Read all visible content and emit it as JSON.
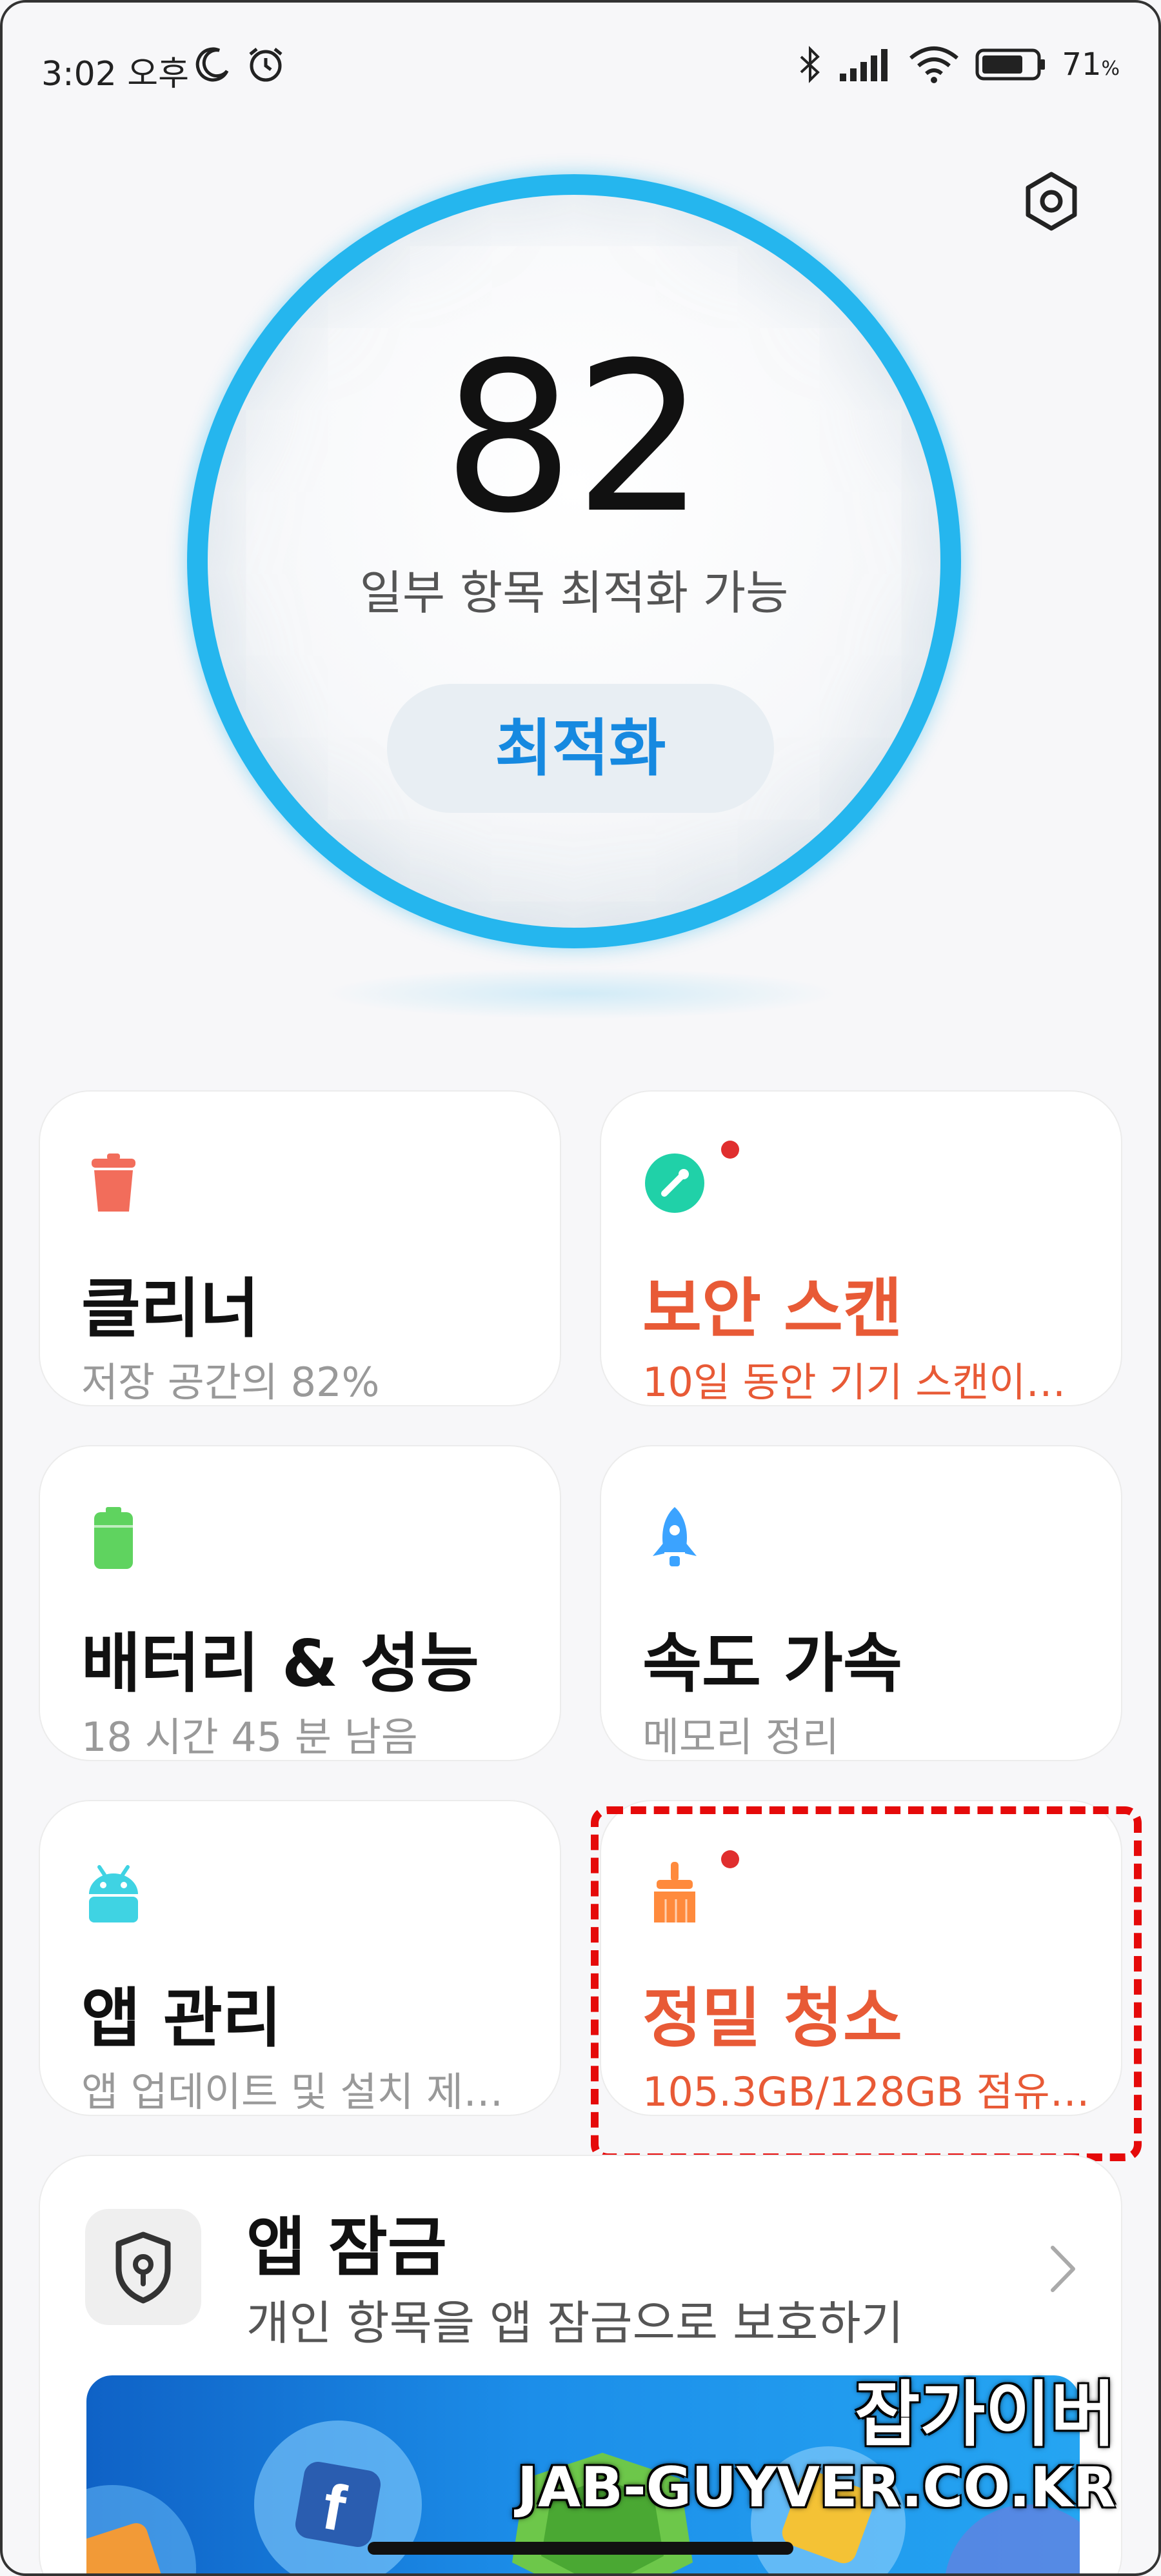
{
  "status_bar": {
    "time": "3:02 오후",
    "battery_pct": "71",
    "battery_unit": "%"
  },
  "score": {
    "value": "82",
    "subtitle": "일부 항목 최적화 가능",
    "optimize_label": "최적화"
  },
  "cards": {
    "cleaner": {
      "title": "클리너",
      "sub": "저장 공간의 82%"
    },
    "security": {
      "title": "보안 스캔",
      "sub": "10일 동안 기기 스캔이…"
    },
    "battery": {
      "title": "배터리 & 성능",
      "sub": "18 시간 45 분  남음"
    },
    "boost": {
      "title": "속도 가속",
      "sub": "메모리 정리"
    },
    "apps": {
      "title": "앱 관리",
      "sub": "앱 업데이트 및 설치 제…"
    },
    "deep_clean": {
      "title": "정밀 청소",
      "sub": "105.3GB/128GB 점유…"
    }
  },
  "app_lock": {
    "title": "앱 잠금",
    "sub": "개인 항목을 앱 잠금으로 보호하기"
  },
  "watermark": {
    "line1": "잡가이버",
    "line2": "JAB-GUYVER.CO.KR"
  },
  "colors": {
    "ring": "#25b6ee",
    "accent_blue": "#1689e0",
    "alert": "#e85a36",
    "cleaner_icon": "#f26d5b",
    "security_icon": "#20d1a8",
    "battery_icon": "#5fd35f",
    "boost_icon": "#3ba3ff",
    "apps_icon": "#3fd3e3",
    "deep_clean_icon": "#ff8a3c",
    "highlight": "#e50a0a"
  },
  "icons": {
    "status": [
      "moon-icon",
      "alarm-icon",
      "bluetooth-icon",
      "signal-icon",
      "wifi-icon",
      "battery-icon"
    ],
    "settings": "settings-hexagon-icon",
    "cleaner": "trash-icon",
    "security": "shield-check-icon",
    "battery": "battery-icon",
    "boost": "rocket-icon",
    "apps": "android-icon",
    "deep_clean": "broom-icon",
    "app_lock": "lock-shield-icon",
    "chevron": "chevron-right-icon"
  }
}
